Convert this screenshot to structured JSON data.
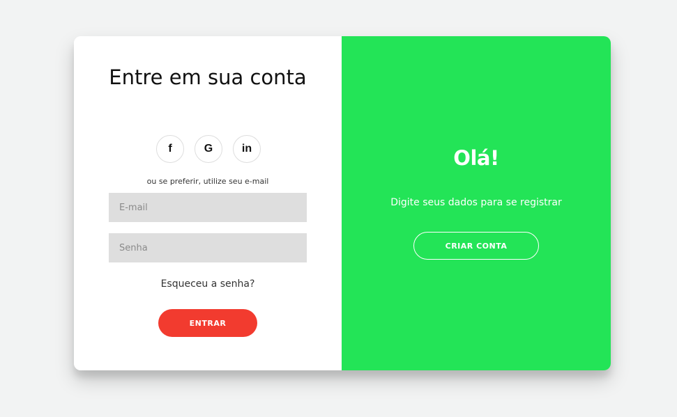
{
  "login": {
    "title": "Entre em sua conta",
    "socials": [
      {
        "label": "f",
        "icon": "facebook-icon"
      },
      {
        "label": "G",
        "icon": "google-icon"
      },
      {
        "label": "in",
        "icon": "linkedin-icon"
      }
    ],
    "hint": "ou se preferir, utilize seu e-mail",
    "email_placeholder": "E-mail",
    "password_placeholder": "Senha",
    "forgot": "Esqueceu a senha?",
    "submit": "ENTRAR"
  },
  "signup": {
    "title": "Olá!",
    "text": "Digite seus dados para se registrar",
    "button": "CRIAR CONTA"
  },
  "colors": {
    "background": "#f2f3f3",
    "accent": "#23e457",
    "primary_button": "#f23b2f",
    "input_background": "#dedede"
  }
}
